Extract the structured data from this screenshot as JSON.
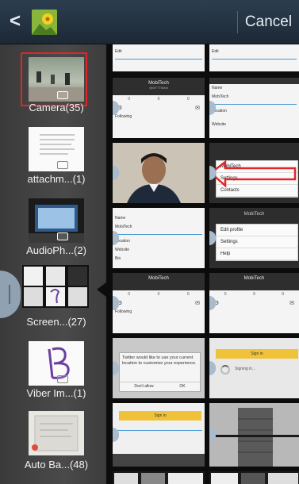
{
  "actionbar": {
    "back_icon": "chevron-left-icon",
    "app_icon": "gallery-sunflower-icon",
    "cancel_label": "Cancel"
  },
  "albums": [
    {
      "name": "Camera(35)",
      "selected": true
    },
    {
      "name": "attachm...(1)",
      "selected": false
    },
    {
      "name": "AudioPh...(2)",
      "selected": false
    },
    {
      "name": "Screen...(27)",
      "selected": false
    },
    {
      "name": "Viber Im...(1)",
      "selected": false
    },
    {
      "name": "Auto Ba...(48)",
      "selected": false
    }
  ],
  "grid": {
    "row1": {
      "left": "Edit",
      "right": "Edit"
    },
    "row2": {
      "left_title": "MobiTech",
      "left_handle": "@MTTTbbbb",
      "left_foot": "Following",
      "right_name": "Name",
      "right_value": "MobiTech",
      "right_loc": "Location",
      "right_web": "Website"
    },
    "row3": {
      "right_menu": [
        "MobiTech",
        "Settings",
        "Contacts",
        "Sign out"
      ]
    },
    "row4": {
      "left_name": "Name",
      "left_value": "MobiTech",
      "left_loc": "Location",
      "left_web": "Website",
      "left_bio": "Bio",
      "right_title": "MobiTech",
      "right_menu": [
        "Edit profile",
        "Settings",
        "Help"
      ]
    },
    "row5": {
      "title": "MobiTech",
      "foot": "Following"
    },
    "row6": {
      "dialog_text": "Twitter would like to use your current location to customize your experience.",
      "dont_allow": "Don't allow",
      "ok": "OK",
      "signin": "Sign in",
      "signing_in": "Signing in..."
    },
    "row7": {
      "signin": "Sign in"
    }
  }
}
